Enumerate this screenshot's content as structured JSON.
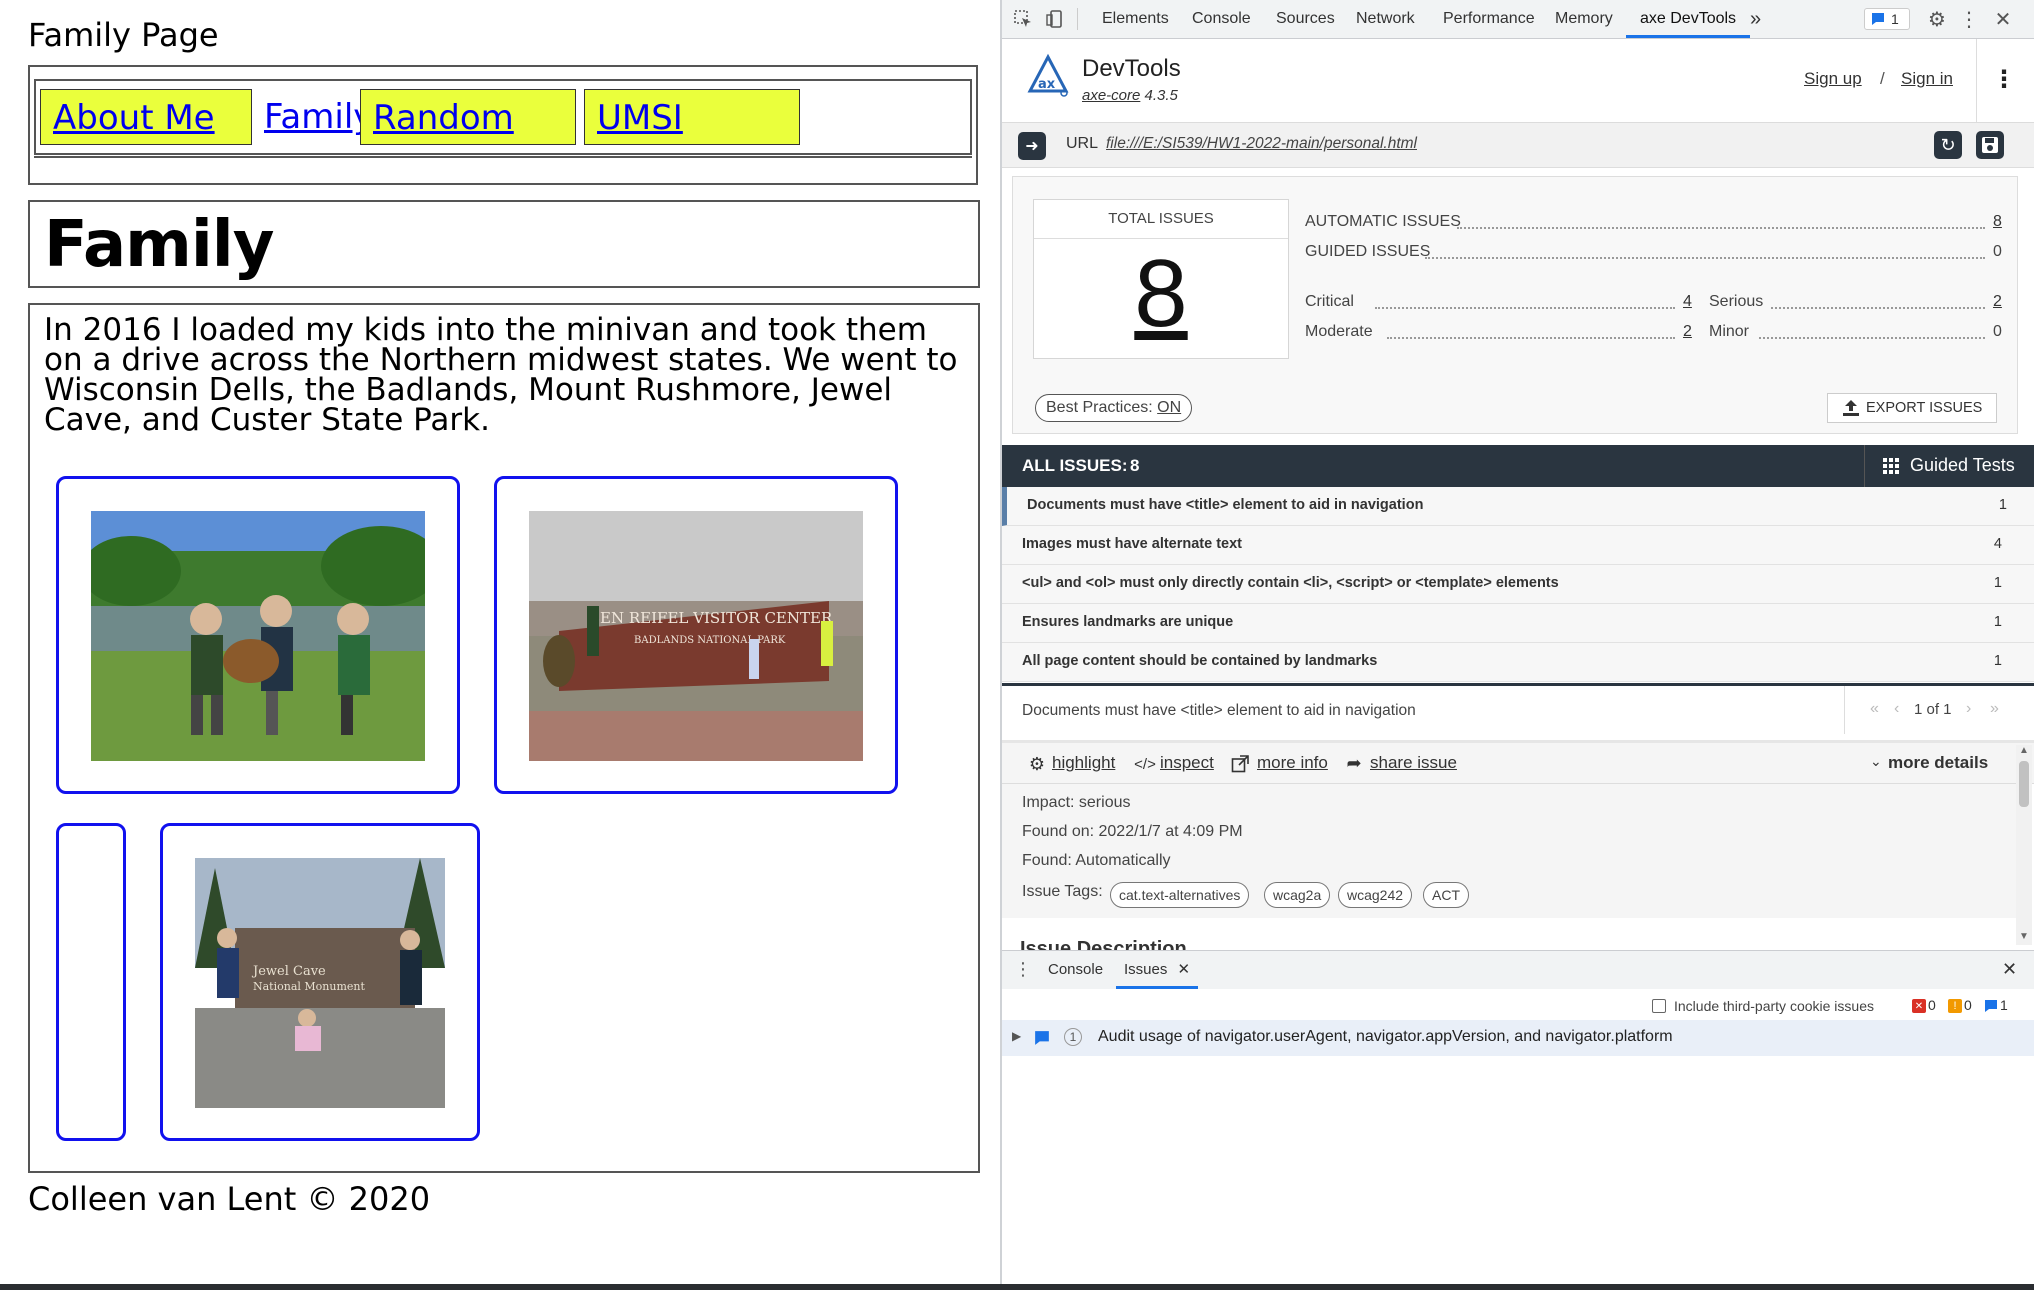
{
  "page": {
    "title": "Family Page",
    "nav": [
      {
        "label": "About Me",
        "highlight": true
      },
      {
        "label": "Family",
        "highlight": false
      },
      {
        "label": "Random",
        "highlight": true
      },
      {
        "label": "UMSI",
        "highlight": true
      }
    ],
    "heading": "Family",
    "paragraph": "In 2016 I loaded my kids into the minivan and took them on a drive across the Northern midwest states. We went to Wisconsin Dells, the Badlands, Mount Rushmore, Jewel Cave, and Custer State Park.",
    "footer": "Colleen van Lent © 2020",
    "photo2_sign": {
      "line1": "BEN REIFEL VISITOR CENTER",
      "line2": "BADLANDS NATIONAL PARK"
    },
    "photo3_sign": {
      "line1": "Jewel Cave",
      "line2": "National Monument"
    }
  },
  "devtools": {
    "tabs": [
      "Elements",
      "Console",
      "Sources",
      "Network",
      "Performance",
      "Memory",
      "axe DevTools"
    ],
    "active_tab": "axe DevTools",
    "more_tabs": "»",
    "issues_badge": "1",
    "brand": "DevTools",
    "axe_core_label": "axe-core",
    "axe_core_version": "4.3.5",
    "sign_up": "Sign up",
    "separator": "/",
    "sign_in": "Sign in",
    "url_label": "URL",
    "url_value": "file:///E:/SI539/HW1-2022-main/personal.html",
    "total_issues_label": "TOTAL ISSUES",
    "total_issues_value": "8",
    "automatic_label": "AUTOMATIC ISSUES",
    "automatic_value": "8",
    "guided_label": "GUIDED ISSUES",
    "guided_value": "0",
    "critical_label": "Critical",
    "critical_value": "4",
    "serious_label": "Serious",
    "serious_value": "2",
    "moderate_label": "Moderate",
    "moderate_value": "2",
    "minor_label": "Minor",
    "minor_value": "0",
    "best_practices_label": "Best Practices:",
    "best_practices_value": "ON",
    "export_label": "EXPORT ISSUES",
    "all_issues_label": "ALL ISSUES:",
    "all_issues_count": "8",
    "guided_tests_label": "Guided Tests",
    "issues": [
      {
        "label": "Documents must have <title> element to aid in navigation",
        "count": "1"
      },
      {
        "label": "Images must have alternate text",
        "count": "4"
      },
      {
        "label": "<ul> and <ol> must only directly contain <li>, <script> or <template> elements",
        "count": "1"
      },
      {
        "label": "Ensures landmarks are unique",
        "count": "1"
      },
      {
        "label": "All page content should be contained by landmarks",
        "count": "1"
      }
    ],
    "detail_title": "Documents must have <title> element to aid in navigation",
    "pager": "1 of 1",
    "actions": {
      "highlight": "highlight",
      "inspect": "inspect",
      "more_info": "more info",
      "share": "share issue",
      "more_details": "more details"
    },
    "impact": "Impact: serious",
    "found_on": "Found on: 2022/1/7 at 4:09 PM",
    "found": "Found: Automatically",
    "tags_label": "Issue Tags:",
    "tags": [
      "cat.text-alternatives",
      "wcag2a",
      "wcag242",
      "ACT"
    ],
    "issue_description": "Issue Description",
    "drawer_tabs": [
      "Console",
      "Issues"
    ],
    "third_party_label": "Include third-party cookie issues",
    "counts": {
      "errors": "0",
      "warnings": "0",
      "info": "1"
    },
    "drawer_issue_count": "1",
    "drawer_issue": "Audit usage of navigator.userAgent, navigator.appVersion, and navigator.platform"
  }
}
